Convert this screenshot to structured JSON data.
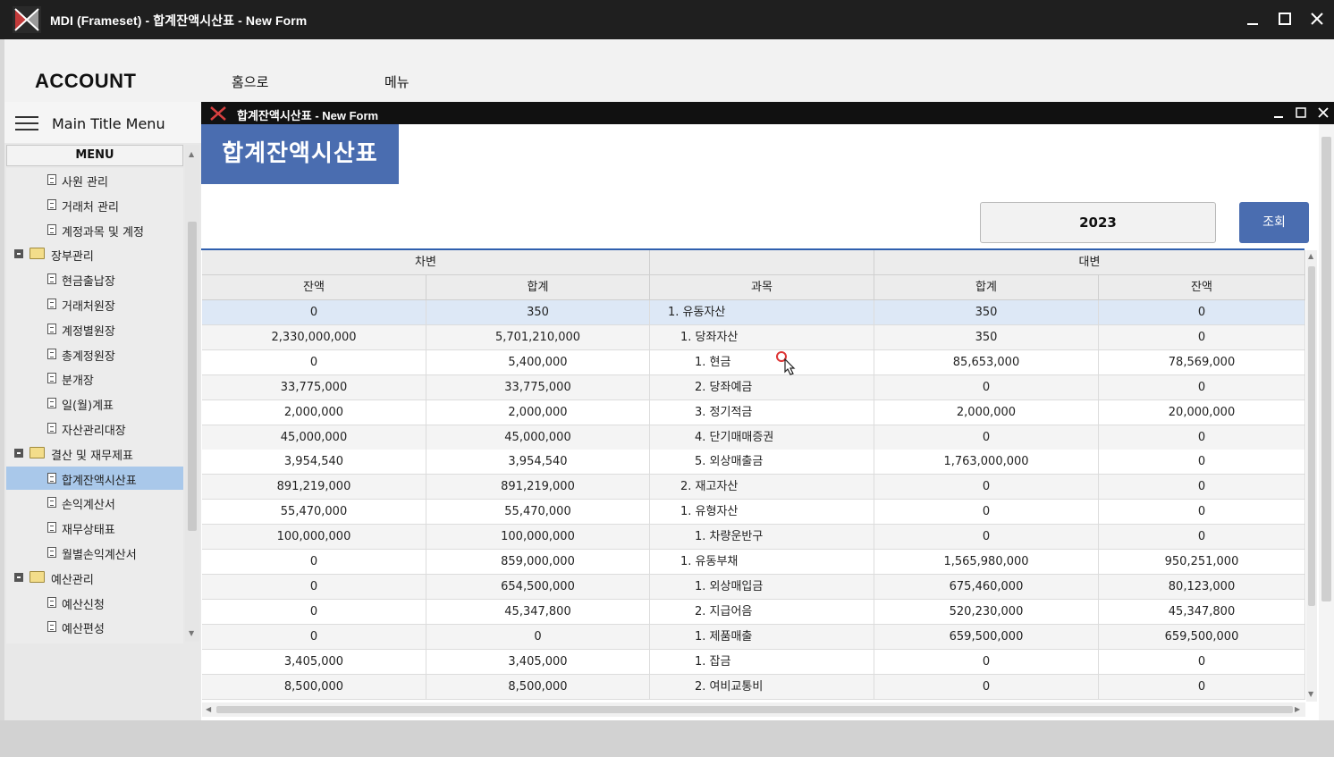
{
  "window": {
    "title": "MDI (Frameset) - 합계잔액시산표 - New Form",
    "controls": [
      "minimize",
      "maximize",
      "close"
    ]
  },
  "header": {
    "brand": "ACCOUNT",
    "nav": [
      "홈으로",
      "메뉴"
    ]
  },
  "left_panel": {
    "menu_title": "Main Title Menu",
    "menu_header": "MENU",
    "tree": [
      {
        "label": "사원 관리",
        "type": "doc",
        "level": 1
      },
      {
        "label": "거래처 관리",
        "type": "doc",
        "level": 1
      },
      {
        "label": "계정과목 및 계정",
        "type": "doc",
        "level": 1
      },
      {
        "label": "장부관리",
        "type": "folder",
        "level": 0
      },
      {
        "label": "현금출납장",
        "type": "doc",
        "level": 1
      },
      {
        "label": "거래처원장",
        "type": "doc",
        "level": 1
      },
      {
        "label": "계정별원장",
        "type": "doc",
        "level": 1
      },
      {
        "label": "총계정원장",
        "type": "doc",
        "level": 1
      },
      {
        "label": "분개장",
        "type": "doc",
        "level": 1
      },
      {
        "label": "일(월)계표",
        "type": "doc",
        "level": 1
      },
      {
        "label": "자산관리대장",
        "type": "doc",
        "level": 1
      },
      {
        "label": "결산 및 재무제표",
        "type": "folder",
        "level": 0
      },
      {
        "label": "합계잔액시산표",
        "type": "doc",
        "level": 1,
        "selected": true
      },
      {
        "label": "손익계산서",
        "type": "doc",
        "level": 1
      },
      {
        "label": "재무상태표",
        "type": "doc",
        "level": 1
      },
      {
        "label": "월별손익계산서",
        "type": "doc",
        "level": 1
      },
      {
        "label": "예산관리",
        "type": "folder",
        "level": 0
      },
      {
        "label": "예산신청",
        "type": "doc",
        "level": 1
      },
      {
        "label": "예산편성",
        "type": "doc",
        "level": 1
      }
    ]
  },
  "child_window": {
    "title": "합계잔액시산표 - New Form",
    "form_title": "합계잔액시산표",
    "year_value": "2023",
    "search_label": "조회"
  },
  "grid": {
    "group_headers": {
      "debit": "차변",
      "credit": "대변"
    },
    "columns": [
      "잔액",
      "합계",
      "과목",
      "합계",
      "잔액"
    ],
    "rows": [
      {
        "debit_balance": "0",
        "debit_total": "350",
        "account": "1. 유동자산",
        "indent": 0,
        "credit_total": "350",
        "credit_balance": "0"
      },
      {
        "debit_balance": "2,330,000,000",
        "debit_total": "5,701,210,000",
        "account": "1. 당좌자산",
        "indent": 1,
        "credit_total": "350",
        "credit_balance": "0"
      },
      {
        "debit_balance": "0",
        "debit_total": "5,400,000",
        "account": "1. 현금",
        "indent": 2,
        "credit_total": "85,653,000",
        "credit_balance": "78,569,000"
      },
      {
        "debit_balance": "33,775,000",
        "debit_total": "33,775,000",
        "account": "2. 당좌예금",
        "indent": 2,
        "credit_total": "0",
        "credit_balance": "0"
      },
      {
        "debit_balance": "2,000,000",
        "debit_total": "2,000,000",
        "account": "3. 정기적금",
        "indent": 2,
        "credit_total": "2,000,000",
        "credit_balance": "20,000,000"
      },
      {
        "debit_balance": "45,000,000",
        "debit_total": "45,000,000",
        "account": "4. 단기매매증권",
        "indent": 2,
        "credit_total": "0",
        "credit_balance": "0"
      },
      {
        "debit_balance": "3,954,540",
        "debit_total": "3,954,540",
        "account": "5. 외상매출금",
        "indent": 2,
        "credit_total": "1,763,000,000",
        "credit_balance": "0"
      },
      {
        "debit_balance": "891,219,000",
        "debit_total": "891,219,000",
        "account": "2. 재고자산",
        "indent": 1,
        "credit_total": "0",
        "credit_balance": "0"
      },
      {
        "debit_balance": "55,470,000",
        "debit_total": "55,470,000",
        "account": "1. 유형자산",
        "indent": 1,
        "credit_total": "0",
        "credit_balance": "0"
      },
      {
        "debit_balance": "100,000,000",
        "debit_total": "100,000,000",
        "account": "1. 차량운반구",
        "indent": 2,
        "credit_total": "0",
        "credit_balance": "0"
      },
      {
        "debit_balance": "0",
        "debit_total": "859,000,000",
        "account": "1. 유동부채",
        "indent": 1,
        "credit_total": "1,565,980,000",
        "credit_balance": "950,251,000"
      },
      {
        "debit_balance": "0",
        "debit_total": "654,500,000",
        "account": "1. 외상매입금",
        "indent": 2,
        "credit_total": "675,460,000",
        "credit_balance": "80,123,000"
      },
      {
        "debit_balance": "0",
        "debit_total": "45,347,800",
        "account": "2. 지급어음",
        "indent": 2,
        "credit_total": "520,230,000",
        "credit_balance": "45,347,800"
      },
      {
        "debit_balance": "0",
        "debit_total": "0",
        "account": "1. 제품매출",
        "indent": 2,
        "credit_total": "659,500,000",
        "credit_balance": "659,500,000"
      },
      {
        "debit_balance": "3,405,000",
        "debit_total": "3,405,000",
        "account": "1. 잡금",
        "indent": 2,
        "credit_total": "0",
        "credit_balance": "0"
      },
      {
        "debit_balance": "8,500,000",
        "debit_total": "8,500,000",
        "account": "2. 여비교통비",
        "indent": 2,
        "credit_total": "0",
        "credit_balance": "0"
      }
    ]
  },
  "colors": {
    "accent": "#4a6db0",
    "selected_tree": "#a9c8ea",
    "selected_row": "#dde8f6",
    "titlebar": "#1f1f1f"
  }
}
